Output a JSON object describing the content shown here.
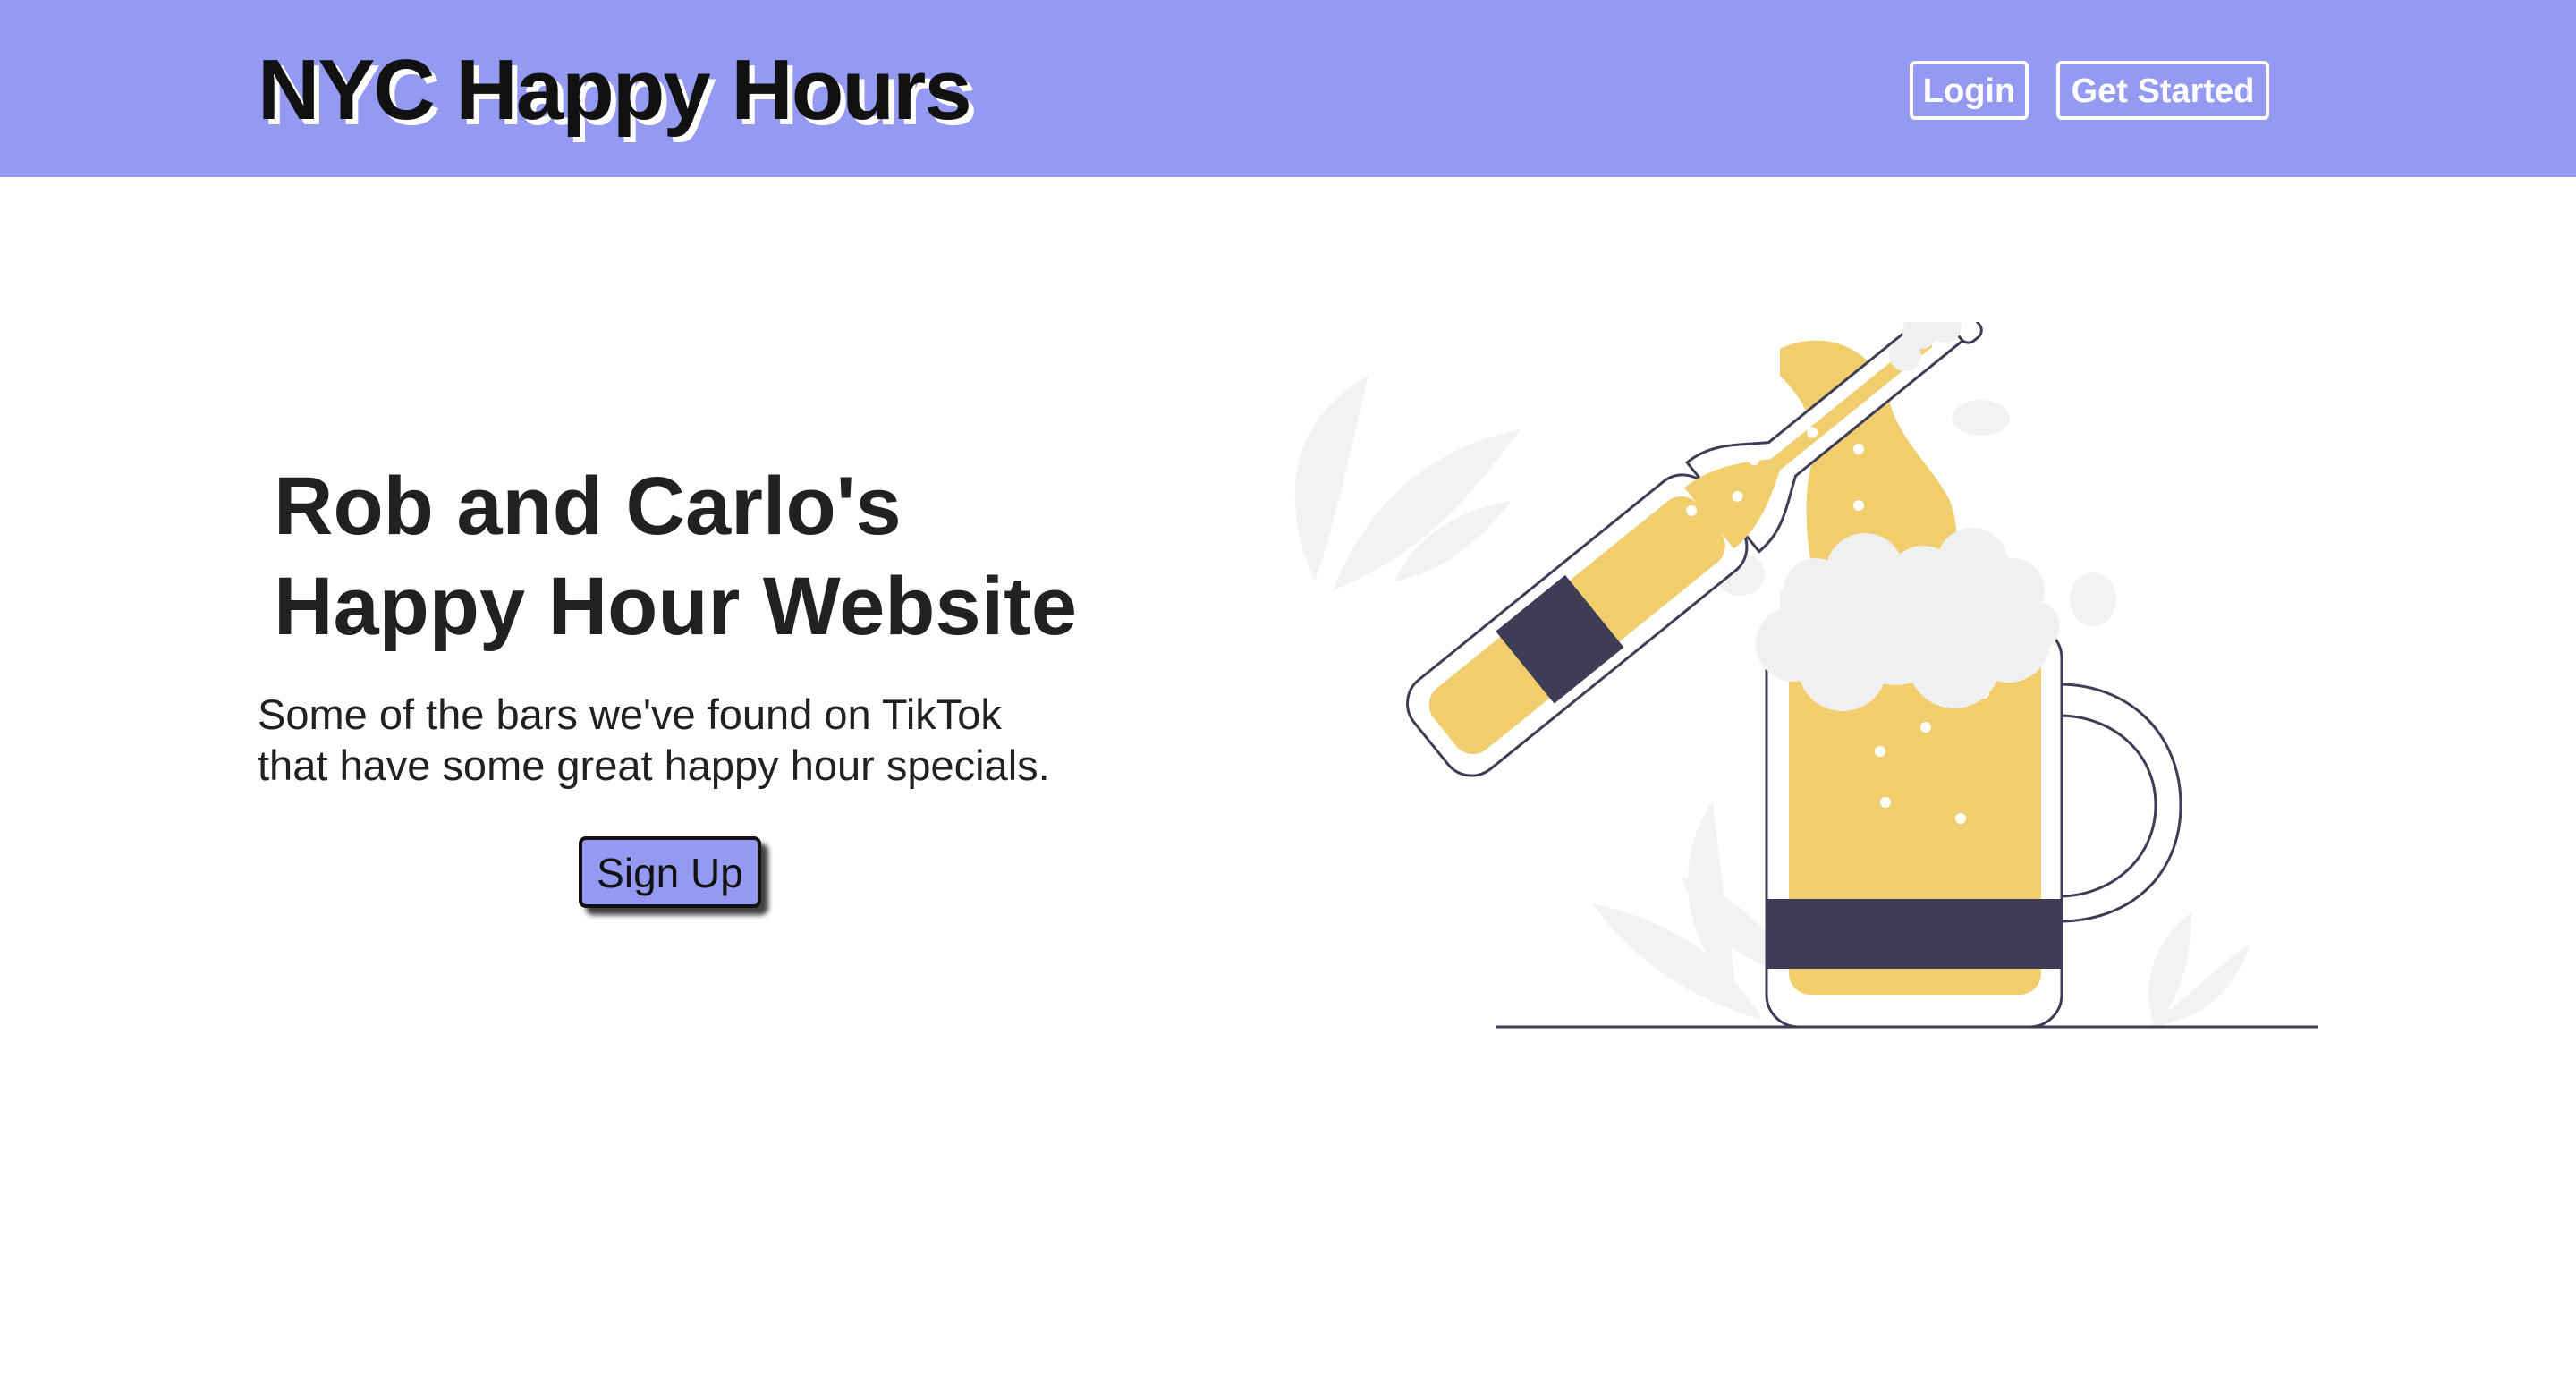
{
  "navbar": {
    "brand": "NYC Happy Hours",
    "login_label": "Login",
    "get_started_label": "Get Started"
  },
  "hero": {
    "title_line1": "Rob and Carlo's",
    "title_line2": "Happy Hour Website",
    "subtitle_line1": "Some of the bars we've found on TikTok",
    "subtitle_line2": "that have some great happy hour specials.",
    "signup_label": "Sign Up"
  },
  "illustration": {
    "subject": "beer-bottle-pouring-into-mug",
    "colors": {
      "beer": "#f0cd6d",
      "foam": "#f0f0f0",
      "dark_band": "#3f3d56",
      "leaves": "#f2f2f2"
    }
  },
  "colors": {
    "navbar": "#9499f2",
    "text": "#212121",
    "button_accent": "#9499f2"
  }
}
